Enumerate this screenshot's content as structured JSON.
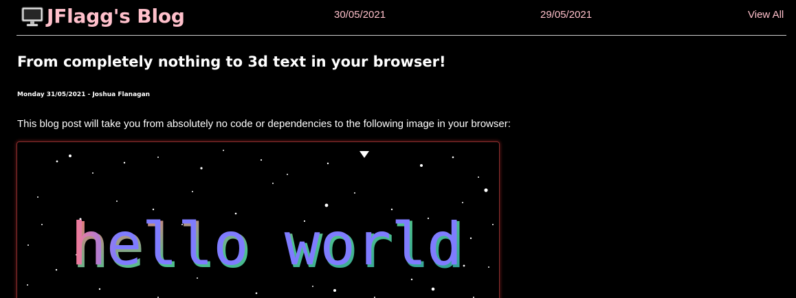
{
  "header": {
    "site_title": "JFlagg's Blog",
    "logo_icon": "monitor-icon",
    "nav_links": [
      {
        "label": "30/05/2021"
      },
      {
        "label": "29/05/2021"
      },
      {
        "label": "View All"
      }
    ]
  },
  "post": {
    "title": "From completely nothing to 3d text in your browser!",
    "meta": "Monday 31/05/2021 - Joshua Flanagan",
    "intro": "This blog post will take you from absolutely no code or dependencies to the following image in your browser:",
    "image": {
      "rendered_text": "hello world"
    }
  },
  "colors": {
    "background": "#000000",
    "link": "#ffc0cb",
    "text": "#ffffff",
    "figure_border": "#8a2f2f"
  }
}
